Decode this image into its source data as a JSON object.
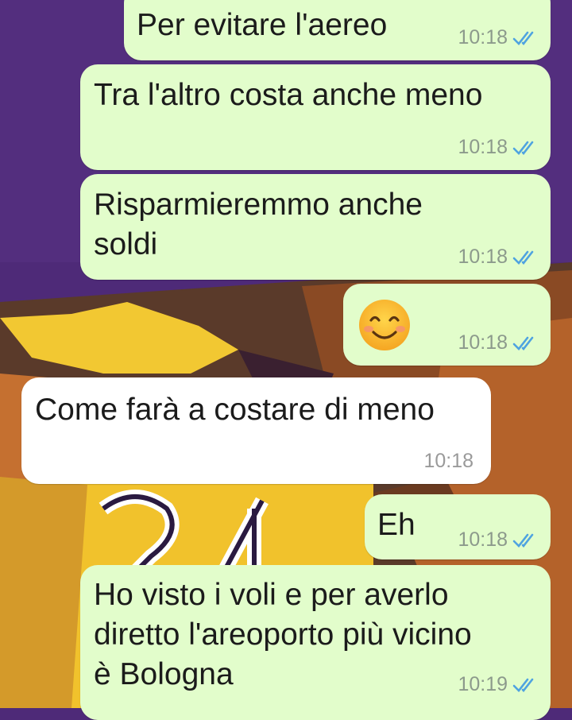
{
  "colors": {
    "outgoing_bubble": "#e2fdcb",
    "incoming_bubble": "#ffffff",
    "read_ticks": "#4fa3e0",
    "wallpaper_base": "#4e2a78"
  },
  "messages": [
    {
      "direction": "out",
      "text": "Per evitare l'aereo",
      "time": "10:18",
      "status": "read-ticks-icon"
    },
    {
      "direction": "out",
      "text": "Tra l'altro costa anche meno",
      "time": "10:18",
      "status": "read-ticks-icon"
    },
    {
      "direction": "out",
      "text": "Risparmieremmo anche\nsoldi",
      "time": "10:18",
      "status": "read-ticks-icon"
    },
    {
      "direction": "out",
      "text": "",
      "emoji": "smiling-face-emoji-icon",
      "time": "10:18",
      "status": "read-ticks-icon"
    },
    {
      "direction": "in",
      "text": "Come farà a costare di meno",
      "time": "10:18"
    },
    {
      "direction": "out",
      "text": "Eh",
      "time": "10:18",
      "status": "read-ticks-icon"
    },
    {
      "direction": "out",
      "text": "Ho visto i voli e per averlo\ndiretto l'areoporto più vicino\nè Bologna",
      "time": "10:19",
      "status": "read-ticks-icon"
    }
  ]
}
